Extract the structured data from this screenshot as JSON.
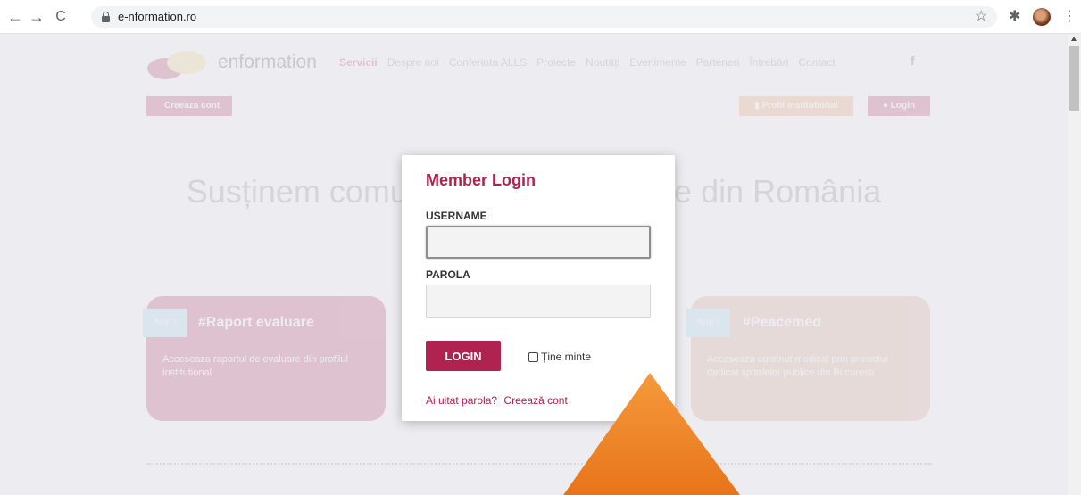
{
  "browser": {
    "url": "e-nformation.ro",
    "back_glyph": "←",
    "forward_glyph": "→",
    "reload_glyph": "C",
    "star_glyph": "☆",
    "extensions_glyph": "✱",
    "menu_glyph": "⋮"
  },
  "site": {
    "logo_text": "enformation",
    "nav": [
      "Servicii",
      "Despre noi",
      "Conferinta ALLS",
      "Proiecte",
      "Noutăți",
      "Evenimente",
      "Parteneri",
      "Întrebări",
      "Contact"
    ],
    "facebook_glyph": "f",
    "create_account": "Creeaza cont",
    "profile_button": "Profil institutional",
    "profile_icon": "book-icon",
    "login_button": "Login",
    "login_icon": "user-icon",
    "hero_text": "Susținem comunitatea de cercetare din România",
    "cards": [
      {
        "badge": "Nou !",
        "title": "#Raport evaluare",
        "text": "Acceseaza raportul de evaluare din profilul institutional"
      },
      {
        "badge": "Nou !",
        "title": "#Peacemed",
        "text": "Acceseaza continut medical prin proiectul dedicat spitalelor publice din Bucuresti"
      }
    ],
    "colors": {
      "brand": "#c0285c",
      "accent": "#f0a061",
      "badge": "#a9d8f2"
    }
  },
  "modal": {
    "title": "Member Login",
    "username_label": "USERNAME",
    "username_value": "",
    "password_label": "PAROLA",
    "password_value": "",
    "login_button": "LOGIN",
    "remember_label": "Ține minte",
    "forgot_link": "Ai uitat parola?",
    "create_link": "Creează cont",
    "colors": {
      "title": "#b0224f",
      "button": "#b0224f"
    }
  },
  "annotation": {
    "shape": "triangle",
    "color": "#f08020"
  }
}
